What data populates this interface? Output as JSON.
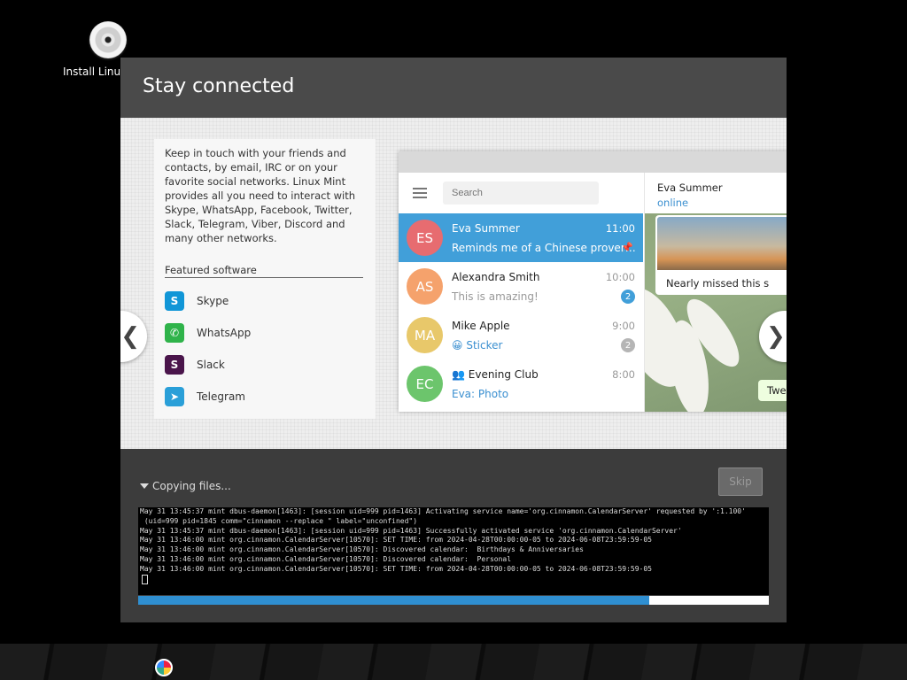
{
  "desktop": {
    "icon_label": "Install Linux Mint",
    "icon_name": "cd-icon"
  },
  "window": {
    "title": "Stay connected"
  },
  "slide": {
    "description": "Keep in touch with your friends and contacts, by email, IRC or on your favorite social networks. Linux Mint provides all you need to interact with Skype, WhatsApp, Facebook, Twitter, Slack, Telegram, Viber, Discord and many other networks.",
    "featured_title": "Featured software",
    "software": [
      {
        "label": "Skype",
        "icon": "skype-icon",
        "glyph": "S",
        "color": "#1196d7"
      },
      {
        "label": "WhatsApp",
        "icon": "whatsapp-icon",
        "glyph": "✆",
        "color": "#2fb34a"
      },
      {
        "label": "Slack",
        "icon": "slack-icon",
        "glyph": "S",
        "color": "#4a154b"
      },
      {
        "label": "Telegram",
        "icon": "telegram-icon",
        "glyph": "➤",
        "color": "#2a9fd8"
      }
    ],
    "telegram": {
      "search_placeholder": "Search",
      "chats": [
        {
          "initials": "ES",
          "name": "Eva Summer",
          "time": "11:00",
          "message": "Reminds me of a Chinese prover…",
          "avatar_color": "#e76c70",
          "active": true,
          "pinned": true
        },
        {
          "initials": "AS",
          "name": "Alexandra Smith",
          "time": "10:00",
          "message": "This is amazing!",
          "avatar_color": "#f5a26c",
          "badge": "2",
          "badge_color": "#419fd9"
        },
        {
          "initials": "MA",
          "name": "Mike Apple",
          "time": "9:00",
          "message": "😀 Sticker",
          "avatar_color": "#e8c86a",
          "badge": "2",
          "badge_color": "#b5b5b5",
          "message_blue": true
        },
        {
          "initials": "EC",
          "name": "👥 Evening Club",
          "time": "8:00",
          "message": "Eva: Photo",
          "avatar_color": "#6cc56c",
          "message_blue": true
        }
      ],
      "contact_name": "Eva Summer",
      "contact_status": "online",
      "photo_caption": "Nearly missed this s",
      "partial_bubble": "Twe"
    },
    "prev_glyph": "❮",
    "next_glyph": "❯"
  },
  "status": {
    "label": "Copying files...",
    "skip_label": "Skip"
  },
  "terminal": {
    "lines": [
      "May 31 13:45:37 mint dbus-daemon[1463]: [session uid=999 pid=1463] Activating service name='org.cinnamon.CalendarServer' requested by ':1.100'",
      " (uid=999 pid=1845 comm=\"cinnamon --replace \" label=\"unconfined\")",
      "May 31 13:45:37 mint dbus-daemon[1463]: [session uid=999 pid=1463] Successfully activated service 'org.cinnamon.CalendarServer'",
      "May 31 13:46:00 mint org.cinnamon.CalendarServer[10570]: SET TIME: from 2024-04-28T00:00:00-05 to 2024-06-08T23:59:59-05",
      "May 31 13:46:00 mint org.cinnamon.CalendarServer[10570]: Discovered calendar:  Birthdays & Anniversaries",
      "May 31 13:46:00 mint org.cinnamon.CalendarServer[10570]: Discovered calendar:  Personal",
      "May 31 13:46:00 mint org.cinnamon.CalendarServer[10570]: SET TIME: from 2024-04-28T00:00:00-05 to 2024-06-08T23:59:59-05"
    ]
  },
  "progress": {
    "fraction": 0.81,
    "color": "#2f8fd1"
  },
  "taskbar": {
    "menu_icon": "mint-menu-icon"
  }
}
